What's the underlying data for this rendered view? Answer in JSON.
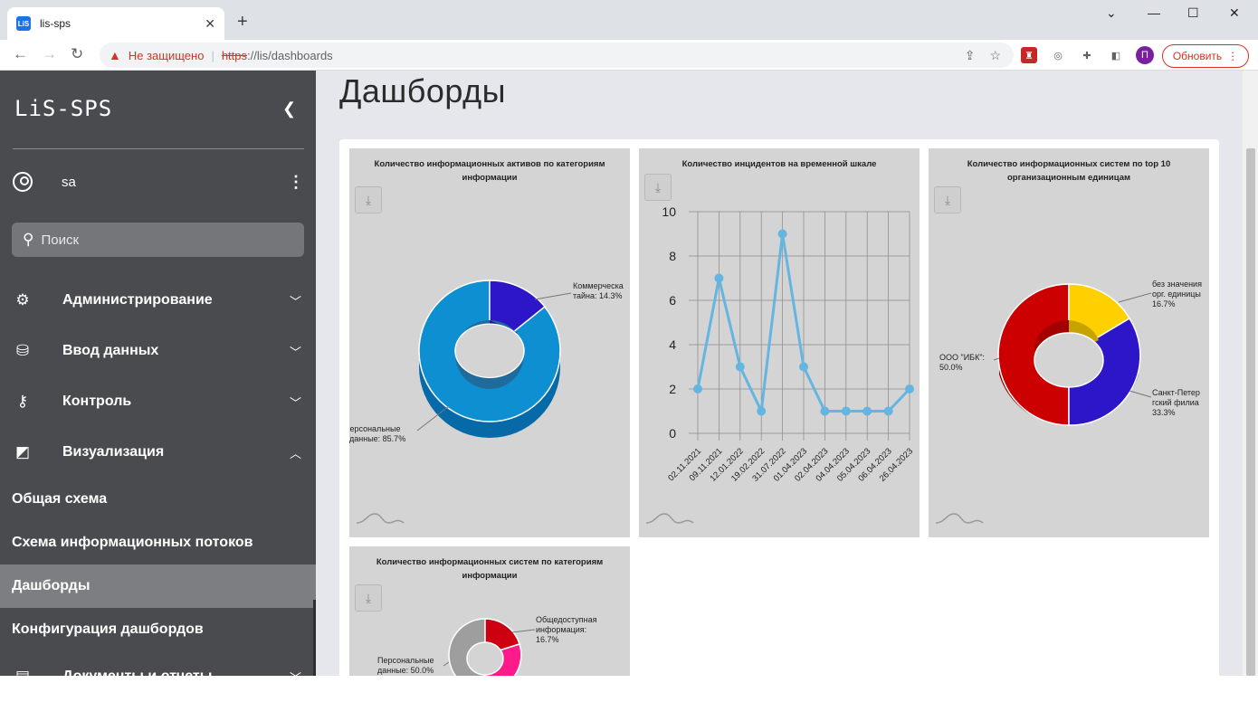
{
  "browser": {
    "tab_title": "lis-sps",
    "tab_favicon": "LiS",
    "security_text": "Не защищено",
    "url_scheme": "https",
    "url_rest": "://lis/dashboards",
    "update_label": "Обновить",
    "profile_initial": "П"
  },
  "sidebar": {
    "logo": "LiS-SPS",
    "user": "sa",
    "search_placeholder": "Поиск",
    "menu": [
      {
        "label": "Администрирование",
        "icon": "gear-icon"
      },
      {
        "label": "Ввод данных",
        "icon": "database-icon"
      },
      {
        "label": "Контроль",
        "icon": "user-lock-icon"
      },
      {
        "label": "Визуализация",
        "icon": "visualization-icon"
      }
    ],
    "submenu": [
      {
        "label": "Общая схема"
      },
      {
        "label": "Схема информационных потоков"
      },
      {
        "label": "Дашборды"
      },
      {
        "label": "Конфигурация дашбордов"
      }
    ],
    "partial_item": "Документы и отчеты"
  },
  "main": {
    "title": "Дашборды",
    "cards": [
      {
        "title": "Количество информационных активов по категориям информации"
      },
      {
        "title": "Количество инцидентов на временной шкале"
      },
      {
        "title": "Количество информационных систем по top 10 организационным единицам"
      },
      {
        "title": "Количество информационных систем по категориям информации"
      }
    ]
  },
  "chart_data": [
    {
      "type": "pie",
      "title": "Количество информационных активов по категориям информации",
      "labels": [
        "Коммерческая тайна",
        "Персональные данные"
      ],
      "values": [
        14.3,
        85.7
      ],
      "colors": [
        "#2c16c8",
        "#0e8fd1"
      ]
    },
    {
      "type": "line",
      "title": "Количество инцидентов на временной шкале",
      "x": [
        "02.11.2021",
        "09.11.2021",
        "12.01.2022",
        "19.02.2022",
        "31.07.2022",
        "01.04.2023",
        "02.04.2023",
        "04.04.2023",
        "05.04.2023",
        "06.04.2023",
        "26.04.2023"
      ],
      "values": [
        2,
        7,
        3,
        1,
        9,
        3,
        1,
        1,
        1,
        1,
        2
      ],
      "ylim": [
        0,
        10
      ],
      "yticks": [
        "0",
        "2",
        "4",
        "6",
        "8",
        "10"
      ],
      "color": "#64b5e0",
      "grid": true
    },
    {
      "type": "pie",
      "title": "Количество информационных систем по top 10 организационным единицам",
      "labels": [
        "без значения орг. единицы",
        "Санкт-Петербургский филиал",
        "ООО \"ИБК\""
      ],
      "values": [
        16.7,
        33.3,
        50.0
      ],
      "colors": [
        "#ffd000",
        "#2c16c8",
        "#cc0000"
      ]
    },
    {
      "type": "pie",
      "title": "Количество информационных систем по категориям информации",
      "labels": [
        "Общедоступная информация",
        "Персональные данные"
      ],
      "values": [
        16.7,
        50.0
      ],
      "colors": [
        "#cc0010",
        "#ff1a8c",
        "#9e9e9e"
      ]
    }
  ],
  "labels": {
    "c1_commercial": [
      "Коммерческа",
      "тайна: 14.3%"
    ],
    "c1_personal": [
      "Персональные",
      "данные: 85.7%"
    ],
    "c3_none": [
      "без значения",
      "орг. единицы",
      "16.7%"
    ],
    "c3_ibk": [
      "ООО \"ИБК\":",
      "50.0%"
    ],
    "c3_spb": [
      "Санкт-Петер",
      "гский филиа",
      "33.3%"
    ],
    "c4_public": [
      "Общедоступная",
      "информация:",
      "16.7%"
    ],
    "c4_personal": [
      "Персональные",
      "данные: 50.0%"
    ]
  }
}
